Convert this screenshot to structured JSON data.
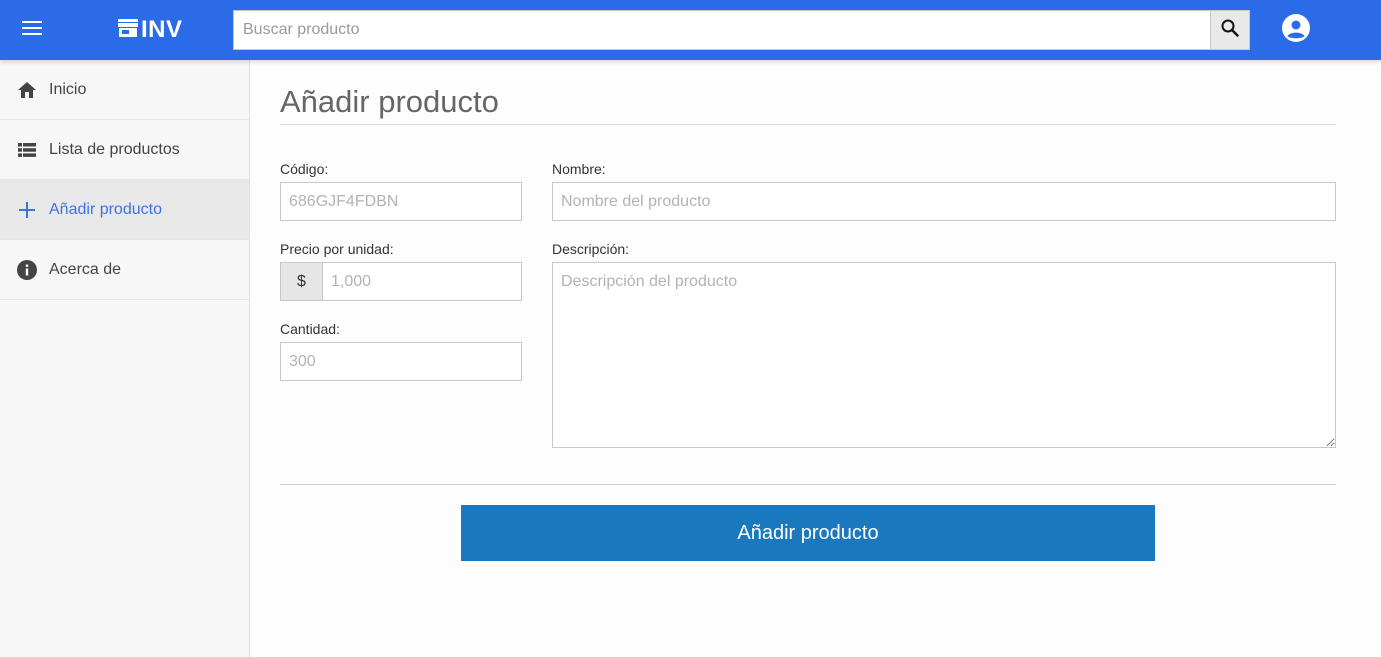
{
  "colors": {
    "topbar": "#2b6be8",
    "accent": "#3e72e0",
    "submit": "#1a78be"
  },
  "header": {
    "brand": "INV",
    "search_placeholder": "Buscar producto"
  },
  "sidebar": {
    "items": [
      {
        "label": "Inicio",
        "icon": "home-icon"
      },
      {
        "label": "Lista de productos",
        "icon": "list-icon"
      },
      {
        "label": "Añadir producto",
        "icon": "plus-icon",
        "active": true
      },
      {
        "label": "Acerca de",
        "icon": "info-icon"
      }
    ]
  },
  "form": {
    "title": "Añadir producto",
    "codigo_label": "Código:",
    "codigo_placeholder": "686GJF4FDBN",
    "nombre_label": "Nombre:",
    "nombre_placeholder": "Nombre del producto",
    "precio_label": "Precio por unidad:",
    "precio_prefix": "$",
    "precio_placeholder": "1,000",
    "descripcion_label": "Descripción:",
    "descripcion_placeholder": "Descripción del producto",
    "cantidad_label": "Cantidad:",
    "cantidad_placeholder": "300",
    "submit_label": "Añadir producto"
  }
}
